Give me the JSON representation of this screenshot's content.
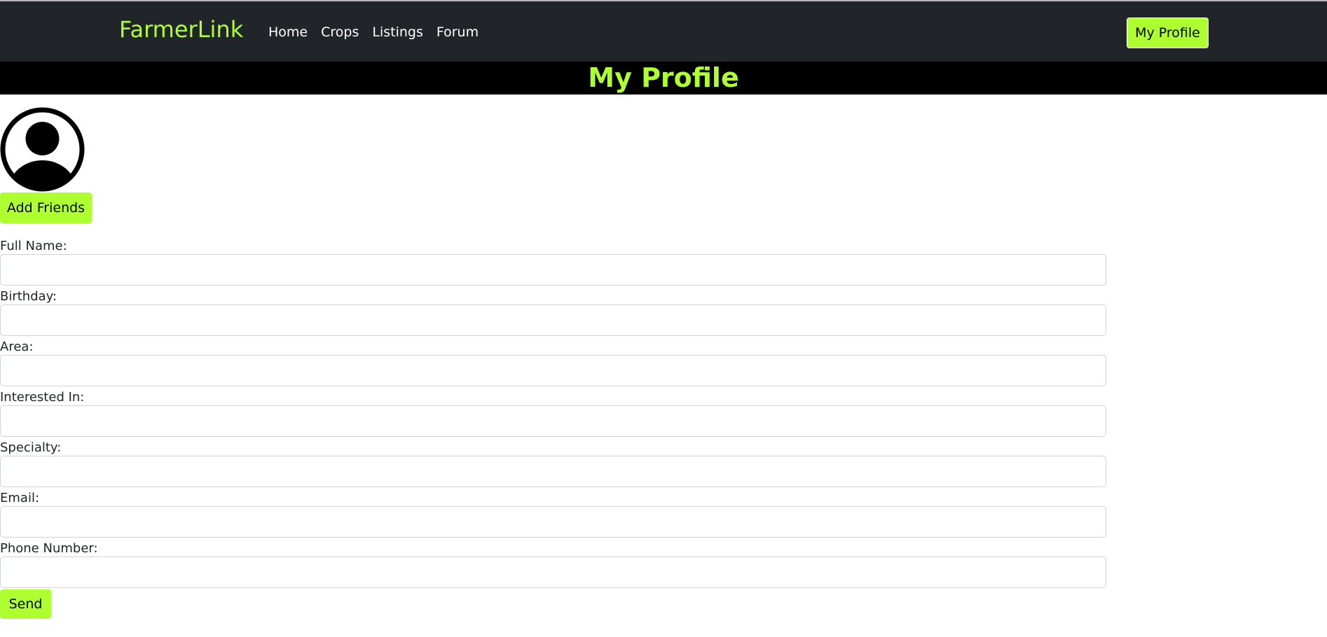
{
  "nav": {
    "brand": "FarmerLink",
    "links": [
      "Home",
      "Crops",
      "Listings",
      "Forum"
    ],
    "profile_button": "My Profile"
  },
  "page": {
    "title": "My Profile"
  },
  "profile": {
    "avatar_icon": "user-avatar-icon",
    "add_friends_label": "Add Friends"
  },
  "form": {
    "fields": [
      {
        "label": "Full Name:",
        "value": "",
        "placeholder": ""
      },
      {
        "label": "Birthday:",
        "value": "",
        "placeholder": ""
      },
      {
        "label": "Area:",
        "value": "",
        "placeholder": ""
      },
      {
        "label": "Interested In:",
        "value": "",
        "placeholder": ""
      },
      {
        "label": "Specialty:",
        "value": "",
        "placeholder": ""
      },
      {
        "label": "Email:",
        "value": "",
        "placeholder": ""
      },
      {
        "label": "Phone Number:",
        "value": "",
        "placeholder": ""
      }
    ],
    "send_label": "Send"
  },
  "colors": {
    "accent": "#adff2f",
    "navbar_bg": "#212529",
    "title_bar_bg": "#000000"
  }
}
